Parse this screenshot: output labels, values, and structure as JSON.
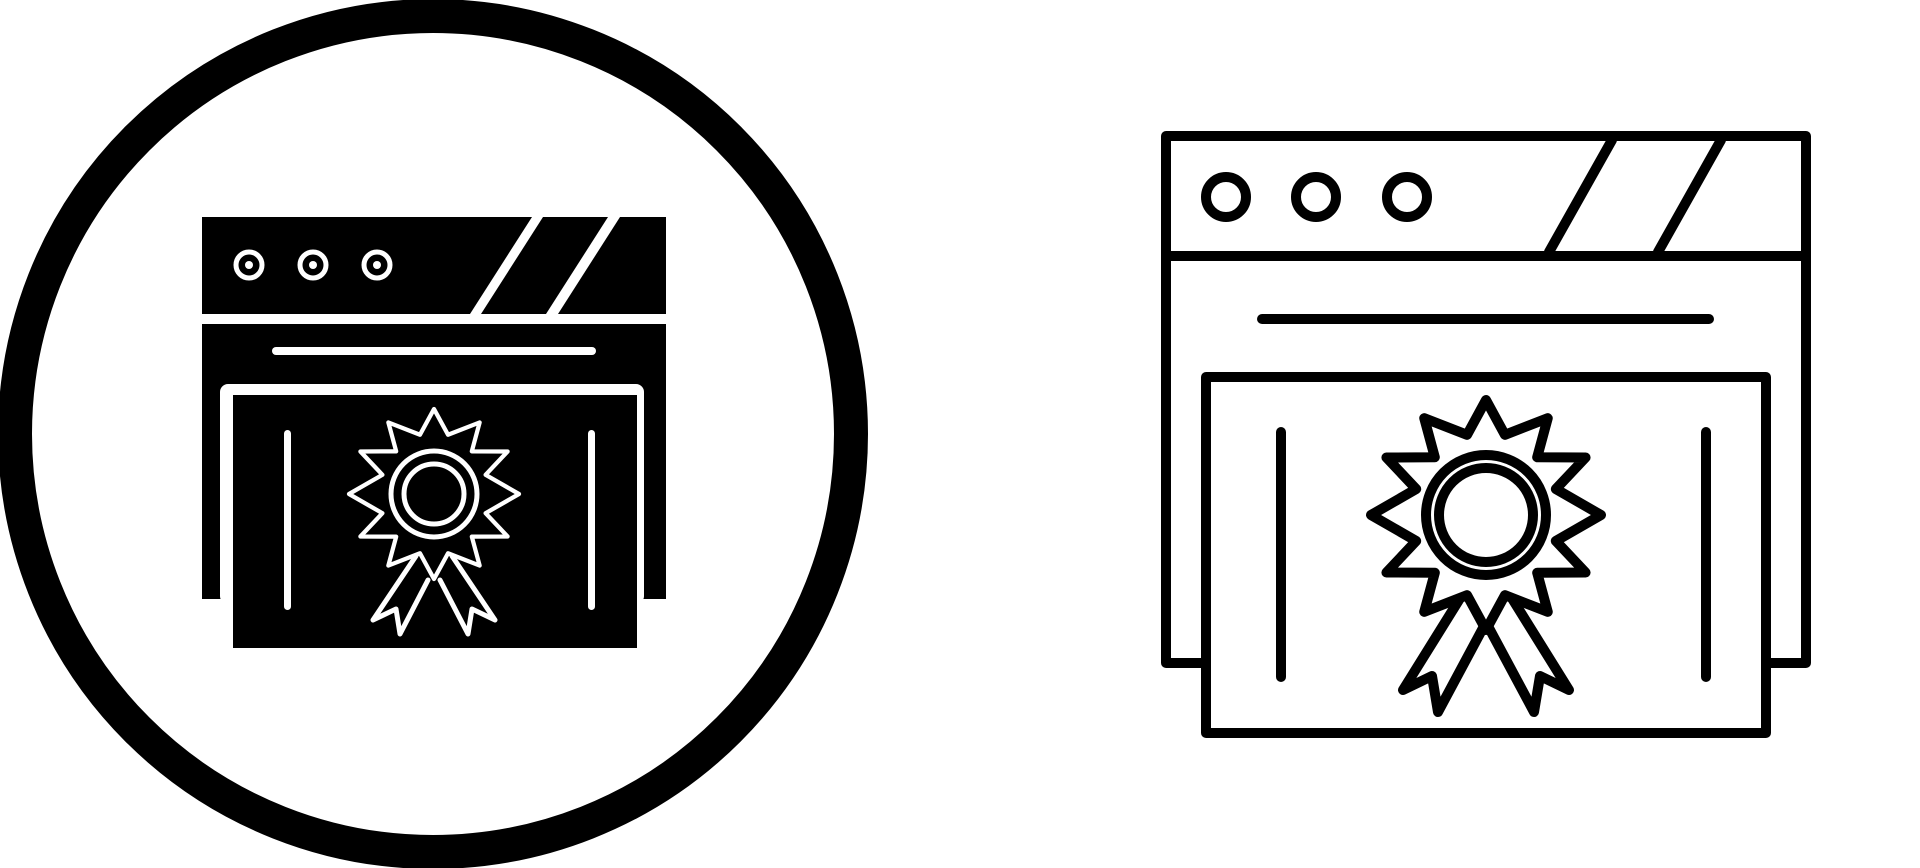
{
  "colors": {
    "ink": "#000000",
    "paper": "#ffffff"
  },
  "icons": [
    {
      "name": "web-certificate-glyph-icon",
      "style": "glyph",
      "container": "circle"
    },
    {
      "name": "web-certificate-line-icon",
      "style": "line",
      "container": "none"
    }
  ]
}
